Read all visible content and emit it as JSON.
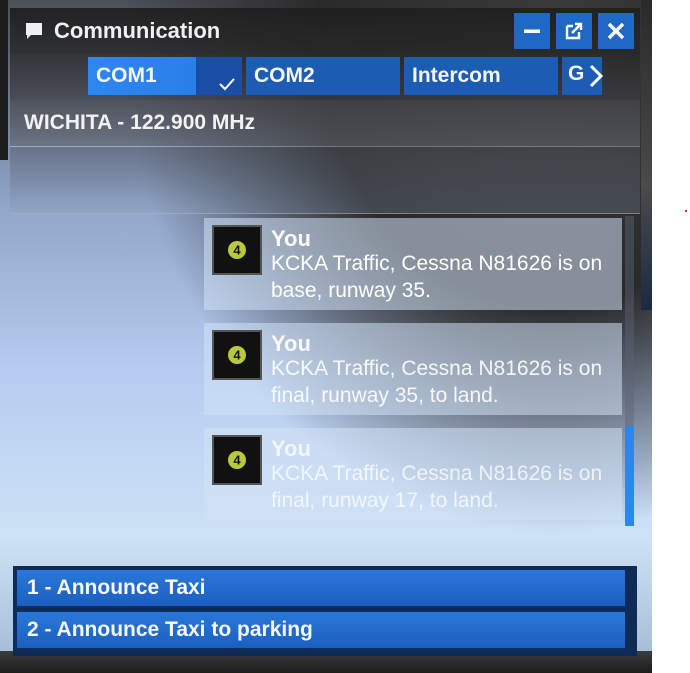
{
  "window": {
    "title": "Communication",
    "title_icon": "chat-bubble-icon",
    "buttons": [
      "minimize-icon",
      "popout-icon",
      "close-icon"
    ]
  },
  "tabs": [
    {
      "label": "COM1",
      "active": true,
      "checked": true
    },
    {
      "label": "COM2",
      "active": false
    },
    {
      "label": "Intercom",
      "active": false
    },
    {
      "label": "G",
      "active": false,
      "truncated": true
    }
  ],
  "frequency": {
    "label": "WICHITA - 122.900 MHz"
  },
  "messages": [
    {
      "sender": "You",
      "text": "KCKA Traffic, Cessna N81626 is on base, runway 35.",
      "avatar_label": "4"
    },
    {
      "sender": "You",
      "text": "KCKA Traffic, Cessna N81626 is on final, runway 35, to land.",
      "avatar_label": "4"
    },
    {
      "sender": "You",
      "text": "KCKA Traffic, Cessna N81626 is on final, runway 17, to land.",
      "avatar_label": "4"
    }
  ],
  "actions": [
    {
      "label": "1 - Announce Taxi"
    },
    {
      "label": "2 - Announce Taxi to parking"
    }
  ],
  "colors": {
    "accent": "#1f68c5",
    "active_tab": "#2f86f0",
    "avatar_ring": "#b9c93a"
  }
}
